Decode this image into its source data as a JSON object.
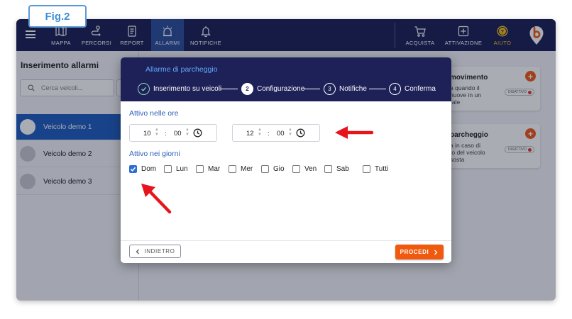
{
  "fig_label": "Fig.2",
  "nav": {
    "items": [
      {
        "label": "MAPPA",
        "icon": "map-icon"
      },
      {
        "label": "PERCORSI",
        "icon": "route-icon"
      },
      {
        "label": "REPORT",
        "icon": "report-icon"
      },
      {
        "label": "ALLARMI",
        "icon": "alarm-icon",
        "active": true
      },
      {
        "label": "NOTIFICHE",
        "icon": "bell-icon"
      }
    ],
    "right_items": [
      {
        "label": "ACQUISTA",
        "icon": "cart-icon"
      },
      {
        "label": "ATTIVAZIONE",
        "icon": "plus-box-icon"
      },
      {
        "label": "AIUTO",
        "icon": "help-icon"
      }
    ],
    "aiuto_color": "#f5c21a"
  },
  "left_panel": {
    "title": "Inserimento allarmi",
    "search_placeholder": "Cerca veicoli...",
    "vehicles": [
      {
        "name": "Veicolo demo 1",
        "selected": true
      },
      {
        "name": "Veicolo demo 2",
        "selected": false
      },
      {
        "name": "Veicolo demo 3",
        "selected": false
      }
    ]
  },
  "cards": [
    {
      "title": "movimento",
      "desc_lines": [
        "a quando il",
        "nuove in un",
        "rale"
      ],
      "status": "DISATTIVO"
    },
    {
      "title": "parcheggio",
      "desc_lines": [
        "a in caso di",
        "to del veicolo",
        "sosta"
      ],
      "status": "DISATTIVO"
    }
  ],
  "modal": {
    "title": "Allarme di parcheggio",
    "steps": [
      {
        "num": "✓",
        "label": "Inserimento su veicoli",
        "state": "done"
      },
      {
        "num": "2",
        "label": "Configurazione",
        "state": "current"
      },
      {
        "num": "3",
        "label": "Notifiche",
        "state": "todo"
      },
      {
        "num": "4",
        "label": "Conferma",
        "state": "todo"
      }
    ],
    "hours_label": "Attivo nelle ore",
    "time_from": {
      "hour": "10",
      "minute": "00"
    },
    "time_to": {
      "hour": "12",
      "minute": "00"
    },
    "time_separator": ":",
    "days_label": "Attivo nei giorni",
    "days": [
      {
        "label": "Dom",
        "checked": true
      },
      {
        "label": "Lun",
        "checked": false
      },
      {
        "label": "Mar",
        "checked": false
      },
      {
        "label": "Mer",
        "checked": false
      },
      {
        "label": "Gio",
        "checked": false
      },
      {
        "label": "Ven",
        "checked": false
      },
      {
        "label": "Sab",
        "checked": false
      },
      {
        "label": "Tutti",
        "checked": false
      }
    ],
    "back_label": "INDIETRO",
    "next_label": "PROCEDI"
  },
  "colors": {
    "nav_bg": "#1d2157",
    "accent_blue": "#1f5fbf",
    "orange": "#f05a0e",
    "arrow_red": "#e8141c"
  }
}
